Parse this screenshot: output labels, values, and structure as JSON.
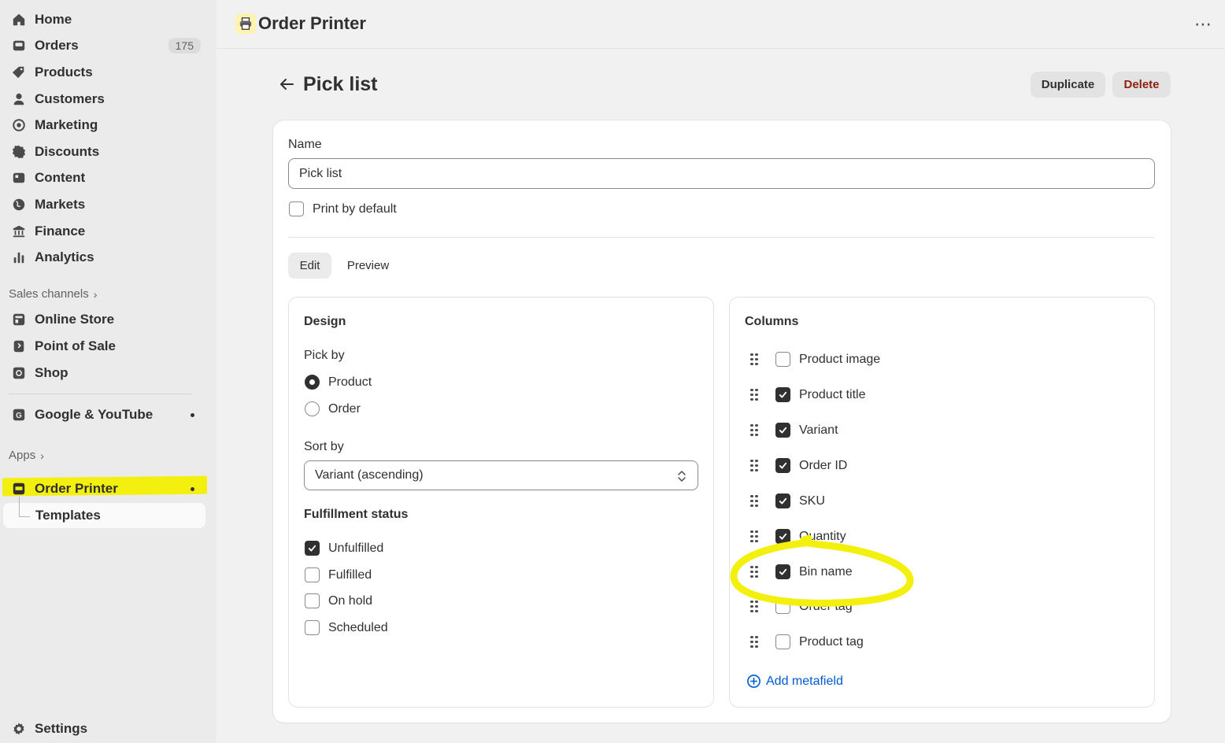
{
  "sidebar": {
    "items": [
      {
        "label": "Home",
        "icon": "home-icon"
      },
      {
        "label": "Orders",
        "icon": "inbox-icon",
        "badge": "175"
      },
      {
        "label": "Products",
        "icon": "tag-icon"
      },
      {
        "label": "Customers",
        "icon": "person-icon"
      },
      {
        "label": "Marketing",
        "icon": "target-icon"
      },
      {
        "label": "Discounts",
        "icon": "discount-icon"
      },
      {
        "label": "Content",
        "icon": "content-icon"
      },
      {
        "label": "Markets",
        "icon": "globe-icon"
      },
      {
        "label": "Finance",
        "icon": "bank-icon"
      },
      {
        "label": "Analytics",
        "icon": "chart-bars-icon"
      }
    ],
    "sales_channels_label": "Sales channels",
    "channels": [
      {
        "label": "Online Store",
        "icon": "store-icon"
      },
      {
        "label": "Point of Sale",
        "icon": "pos-icon"
      },
      {
        "label": "Shop",
        "icon": "shop-icon"
      }
    ],
    "google": {
      "label": "Google & YouTube",
      "icon": "google-icon"
    },
    "apps_label": "Apps",
    "order_printer": {
      "label": "Order Printer",
      "icon": "printer-icon"
    },
    "templates": {
      "label": "Templates"
    },
    "settings": {
      "label": "Settings",
      "icon": "gear-icon"
    }
  },
  "topbar": {
    "app_title": "Order Printer",
    "more": "⋯"
  },
  "page": {
    "title": "Pick list",
    "duplicate_label": "Duplicate",
    "delete_label": "Delete"
  },
  "form": {
    "name_label": "Name",
    "name_value": "Pick list",
    "print_by_default_label": "Print by default",
    "print_by_default_checked": false,
    "tabs": [
      {
        "label": "Edit",
        "active": true
      },
      {
        "label": "Preview",
        "active": false
      }
    ]
  },
  "design": {
    "title": "Design",
    "pick_by_label": "Pick by",
    "pick_by_options": [
      {
        "label": "Product",
        "selected": true
      },
      {
        "label": "Order",
        "selected": false
      }
    ],
    "sort_by_label": "Sort by",
    "sort_by_value": "Variant (ascending)",
    "fulfillment_label": "Fulfillment status",
    "fulfillment_options": [
      {
        "label": "Unfulfilled",
        "checked": true
      },
      {
        "label": "Fulfilled",
        "checked": false
      },
      {
        "label": "On hold",
        "checked": false
      },
      {
        "label": "Scheduled",
        "checked": false
      }
    ]
  },
  "columns": {
    "title": "Columns",
    "items": [
      {
        "label": "Product image",
        "checked": false
      },
      {
        "label": "Product title",
        "checked": true
      },
      {
        "label": "Variant",
        "checked": true
      },
      {
        "label": "Order ID",
        "checked": true
      },
      {
        "label": "SKU",
        "checked": true
      },
      {
        "label": "Quantity",
        "checked": true
      },
      {
        "label": "Bin name",
        "checked": true
      },
      {
        "label": "Order tag",
        "checked": false
      },
      {
        "label": "Product tag",
        "checked": false
      }
    ],
    "add_metafield_label": "Add metafield"
  },
  "colors": {
    "highlight": "#f3f010",
    "link": "#005bd3",
    "danger": "#8e1f0b"
  }
}
